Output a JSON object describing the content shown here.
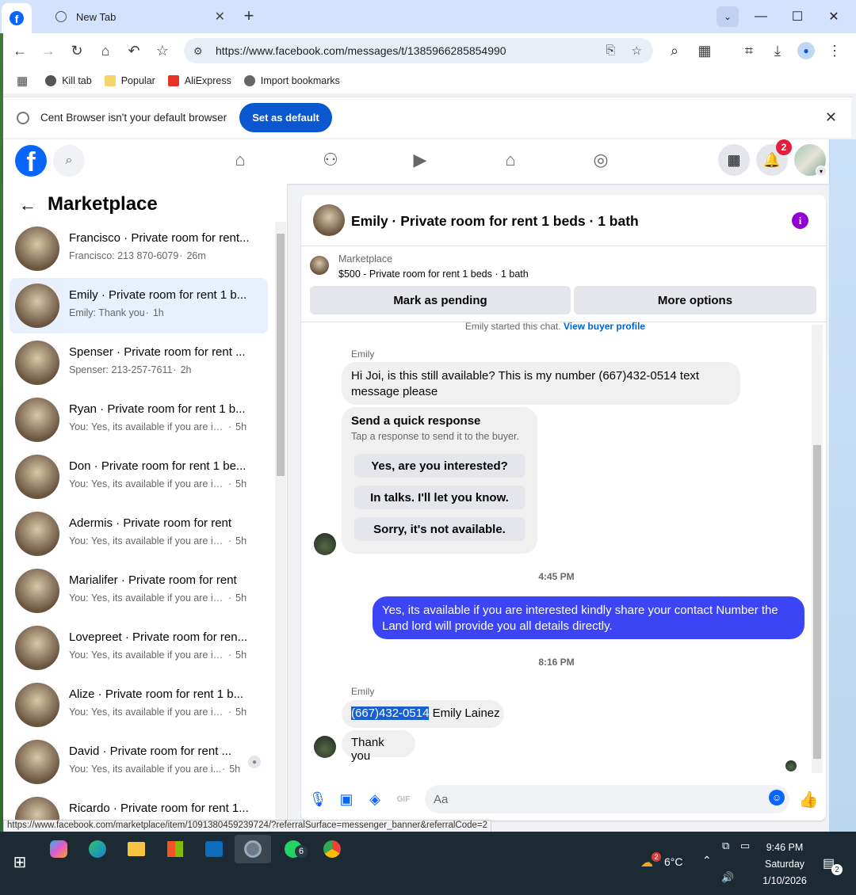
{
  "browser": {
    "tabs": [
      {
        "label": ""
      },
      {
        "label": "New Tab"
      }
    ],
    "url": "https://www.facebook.com/messages/t/1385966285854990",
    "bookmarks": [
      "Kill tab",
      "Popular",
      "AliExpress",
      "Import bookmarks"
    ],
    "infobar": {
      "message": "Cent Browser isn't your default browser",
      "button": "Set as default"
    },
    "status_url": "https://www.facebook.com/marketplace/item/1091380459239724/?referralSurface=messenger_banner&referralCode=2"
  },
  "facebook": {
    "notification_count": "2",
    "sidebar": {
      "title": "Marketplace",
      "conversations": [
        {
          "name": "Francisco · Private room for rent...",
          "preview": "Francisco: 213 870-6079",
          "time": "26m",
          "selected": false
        },
        {
          "name": "Emily · Private room for rent 1 b...",
          "preview": "Emily: Thank you",
          "time": "1h",
          "selected": true
        },
        {
          "name": "Spenser · Private room for rent ...",
          "preview": "Spenser: 213-257-7611",
          "time": "2h",
          "selected": false
        },
        {
          "name": "Ryan · Private room for rent 1 b...",
          "preview": "You: Yes, its available if you are inte...",
          "time": "5h",
          "selected": false
        },
        {
          "name": "Don · Private room for rent 1 be...",
          "preview": "You: Yes, its available if you are inte...",
          "time": "5h",
          "selected": false
        },
        {
          "name": "Adermis · Private room for rent",
          "preview": "You: Yes, its available if you are inte...",
          "time": "5h",
          "selected": false
        },
        {
          "name": "Marialifer · Private room for rent",
          "preview": "You: Yes, its available if you are inte...",
          "time": "5h",
          "selected": false
        },
        {
          "name": "Lovepreet · Private room for ren...",
          "preview": "You: Yes, its available if you are inte...",
          "time": "5h",
          "selected": false
        },
        {
          "name": "Alize · Private room for rent 1 b...",
          "preview": "You: Yes, its available if you are inte...",
          "time": "5h",
          "selected": false
        },
        {
          "name": "David · Private room for rent ...",
          "preview": "You: Yes, its available if you are i...",
          "time": "5h",
          "selected": false
        },
        {
          "name": "Ricardo · Private room for rent 1...",
          "preview": "",
          "time": "",
          "selected": false
        }
      ]
    },
    "chat": {
      "title": "Emily · Private room for rent 1 beds · 1 bath",
      "listing_label": "Marketplace",
      "listing_item": "$500 - Private room for rent 1 beds · 1 bath",
      "mark_pending": "Mark as pending",
      "more_options": "More options",
      "started_text": "Emily started this chat.",
      "view_profile": "View buyer profile",
      "sender1": "Emily",
      "msg1": "Hi Joi, is this still available? This is my number (667)432-0514 text message please",
      "quick_title": "Send a quick response",
      "quick_sub": "Tap a response to send it to the buyer.",
      "quick_responses": [
        "Yes, are you interested?",
        "In talks. I'll let you know.",
        "Sorry, it's not available."
      ],
      "time1": "4:45 PM",
      "msg_out": "Yes, its available if you are interested kindly share your contact Number the Land lord will provide you all details directly.",
      "time2": "8:16 PM",
      "sender2": "Emily",
      "msg2_highlight": "(667)432-0514",
      "msg2_rest": " Emily Lainez",
      "msg3": "Thank you",
      "composer_placeholder": "Aa"
    }
  },
  "taskbar": {
    "weather": "6°C",
    "weather_badge": "2",
    "whatsapp_badge": "6",
    "time": "9:46 PM",
    "day": "Saturday",
    "date": "1/10/2026",
    "notif_count": "2"
  }
}
